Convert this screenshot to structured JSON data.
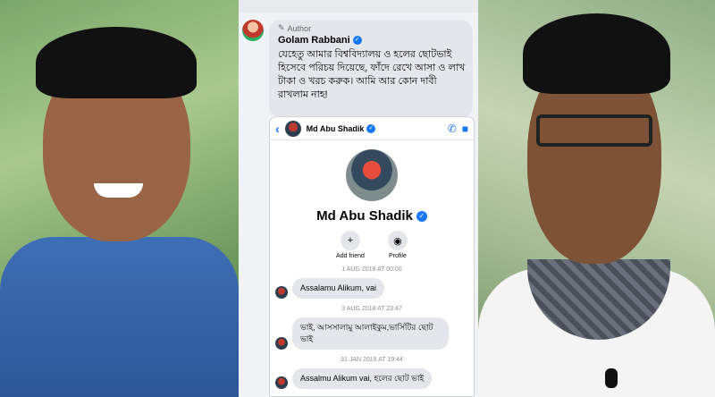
{
  "comment": {
    "author_tag": "Author",
    "author_name": "Golam Rabbani",
    "text": "যেহেতু আমার বিশ্ববিদ্যালয় ও হলের ছোটভাই হিসেবে পরিচয় দিয়েছে, ফাঁদে রেখে আসা ও লাখ টাকা ও খরচ করুক। আমি আর কোন দাবী রাখলাম নাহ!"
  },
  "messenger": {
    "contact_name": "Md Abu Shadik",
    "actions": [
      {
        "label": "Add friend"
      },
      {
        "label": "Profile"
      }
    ],
    "messages": [
      {
        "date": "1 AUG 2018 AT 00:00",
        "text": "Assalamu Alikum, vai"
      },
      {
        "date": "3 AUG 2018 AT 23:47",
        "text": "ভাই, আসসালামু আলাইকুম,ভার্সিটির ছোট ভাই"
      },
      {
        "date": "31 JAN 2019 AT 19:44",
        "text": "Assalmu Alikum vai, হলের ছোট ভাই"
      }
    ]
  },
  "colors": {
    "accent": "#1877f2",
    "bubble": "#e4e6eb"
  }
}
